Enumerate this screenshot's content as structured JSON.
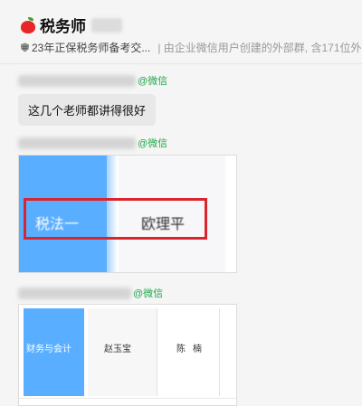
{
  "header": {
    "title": "税务师",
    "group_name": "23年正保税务师备考交...",
    "group_note": "| 由企业微信用户创建的外部群, 含171位外"
  },
  "messages": [
    {
      "sender_suffix": "@微信",
      "text": "这几个老师都讲得很好"
    },
    {
      "sender_suffix": "@微信",
      "image": {
        "subject": "税法一",
        "teacher": "欧理平"
      }
    },
    {
      "sender_suffix": "@微信",
      "image": {
        "subject": "财务与会计",
        "teacher1": "赵玉宝",
        "teacher2": "陈楠"
      }
    }
  ],
  "colors": {
    "wechat_green": "#22a64a",
    "table_blue": "#5aaeff",
    "highlight_red": "#d9262c",
    "bubble_gray": "#e8e8e8"
  }
}
